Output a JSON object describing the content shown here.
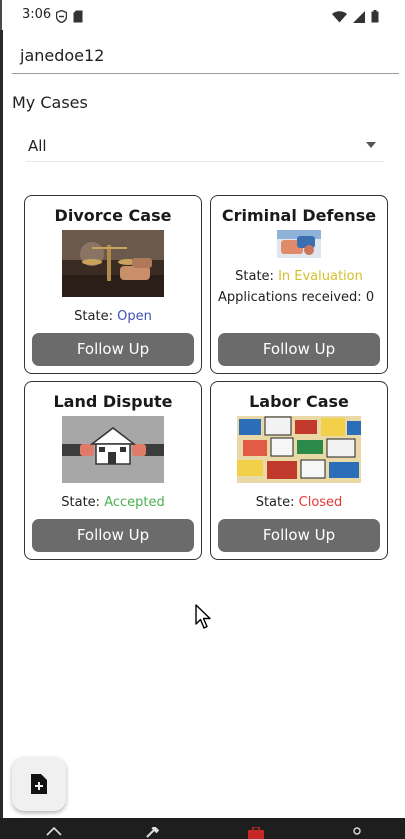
{
  "status_bar": {
    "time": "3:06",
    "left_icons": [
      "shield-icon",
      "sd-card-icon"
    ],
    "right_icons": [
      "wifi-icon",
      "signal-icon",
      "battery-icon"
    ]
  },
  "user": {
    "username": "janedoe12"
  },
  "section": {
    "title": "My Cases"
  },
  "filter": {
    "selected": "All"
  },
  "cases": [
    {
      "title": "Divorce Case",
      "image": "divorce-case-image",
      "state_label": "State: ",
      "state_value": "Open",
      "state_color": "#3f51b5",
      "button_label": "Follow Up"
    },
    {
      "title": "Criminal Defense",
      "image": "criminal-defense-image",
      "state_label": "State: ",
      "state_value": "In Evaluation",
      "state_color": "#d4c12c",
      "applications_label": "Applications received: ",
      "applications_count": "0",
      "button_label": "Follow Up"
    },
    {
      "title": "Land Dispute",
      "image": "land-dispute-image",
      "state_label": "State: ",
      "state_value": "Accepted",
      "state_color": "#4caf50",
      "button_label": "Follow Up"
    },
    {
      "title": "Labor Case",
      "image": "labor-case-image",
      "state_label": "State: ",
      "state_value": "Closed",
      "state_color": "#e53935",
      "button_label": "Follow Up"
    }
  ],
  "fab": {
    "icon": "add-document-icon"
  },
  "bottom_nav": {
    "icons": [
      "home-icon",
      "gavel-icon",
      "briefcase-icon",
      "profile-icon"
    ],
    "active_color": "#c62828"
  }
}
